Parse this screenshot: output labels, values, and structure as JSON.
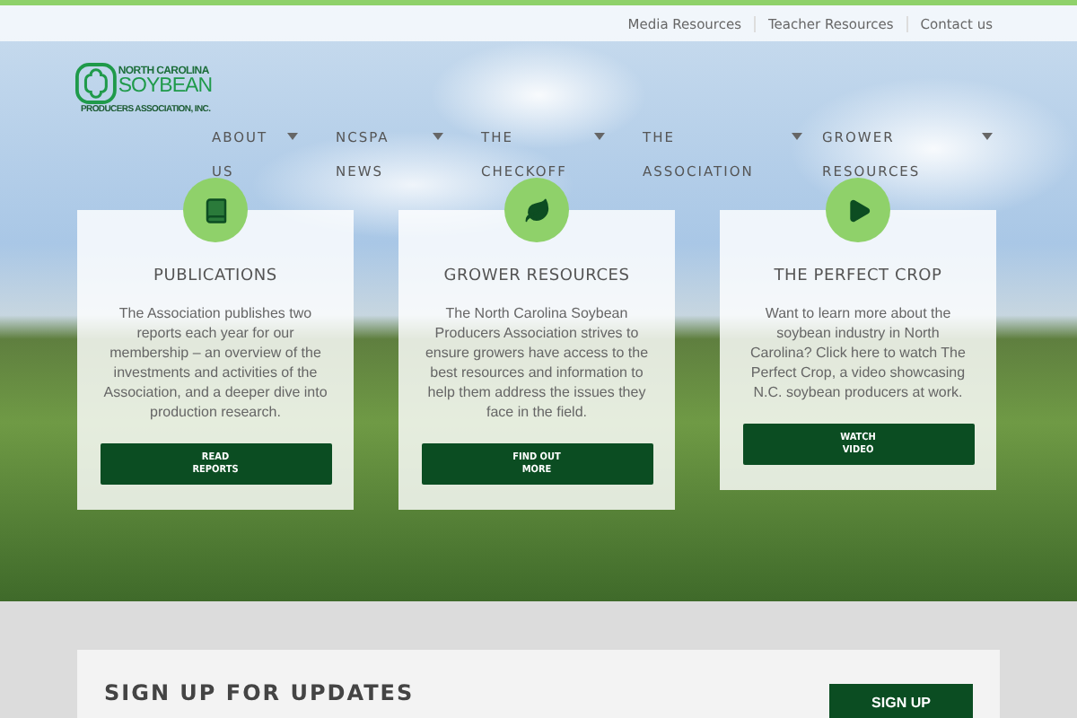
{
  "top_links": [
    "Media Resources",
    "Teacher Resources",
    "Contact us"
  ],
  "logo": {
    "line_1": "NORTH CAROLINA",
    "line_2": "SOYBEAN",
    "line_3": "PRODUCERS ASSOCIATION, INC."
  },
  "nav": [
    {
      "label": "ABOUT US"
    },
    {
      "label": "NCSPA NEWS"
    },
    {
      "label": "THE CHECKOFF"
    },
    {
      "label": "THE ASSOCIATION"
    },
    {
      "label": "GROWER RESOURCES"
    }
  ],
  "cards": [
    {
      "title": "PUBLICATIONS",
      "text": "The Association publishes two reports each year for our membership – an overview of the investments and activities of the Association, and a deeper dive into production research.",
      "button": "READ REPORTS"
    },
    {
      "title": "GROWER RESOURCES",
      "text": "The North Carolina Soybean Producers Association strives to ensure growers have access to the best resources and information to help them address the issues they face in the field.",
      "button": "FIND OUT MORE"
    },
    {
      "title": "THE PERFECT CROP",
      "text": "Want to learn more about the soybean industry in North Carolina? Click here to watch The Perfect Crop, a video showcasing N.C. soybean producers at work.",
      "button": "WATCH VIDEO"
    }
  ],
  "signup": {
    "title": "SIGN UP FOR UPDATES",
    "button": "SIGN UP"
  }
}
